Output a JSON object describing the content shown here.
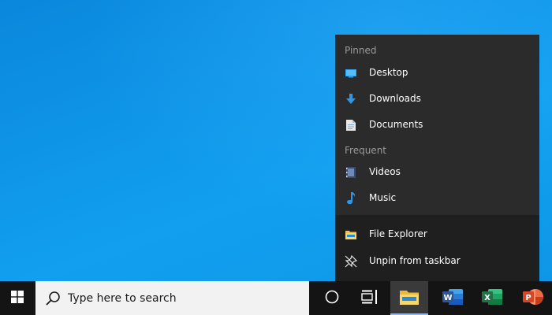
{
  "jumplist": {
    "pinned_header": "Pinned",
    "pinned": [
      {
        "label": "Desktop",
        "icon": "desktop-folder-icon"
      },
      {
        "label": "Downloads",
        "icon": "download-arrow-icon"
      },
      {
        "label": "Documents",
        "icon": "document-icon"
      }
    ],
    "frequent_header": "Frequent",
    "frequent": [
      {
        "label": "Videos",
        "icon": "video-icon"
      },
      {
        "label": "Music",
        "icon": "music-note-icon"
      }
    ],
    "actions": [
      {
        "label": "File Explorer",
        "icon": "file-explorer-icon"
      },
      {
        "label": "Unpin from taskbar",
        "icon": "unpin-icon"
      }
    ]
  },
  "taskbar": {
    "search_placeholder": "Type here to search",
    "apps": [
      {
        "name": "File Explorer",
        "icon": "file-explorer-icon",
        "active": true
      },
      {
        "name": "Word",
        "icon": "word-icon",
        "active": false
      },
      {
        "name": "Excel",
        "icon": "excel-icon",
        "active": false
      },
      {
        "name": "PowerPoint",
        "icon": "powerpoint-icon",
        "active": false
      }
    ],
    "colors": {
      "taskbar_bg": "#141414",
      "accent": "#0a87dc",
      "word": "#2b579a",
      "excel": "#217346",
      "powerpoint": "#d24726"
    }
  }
}
